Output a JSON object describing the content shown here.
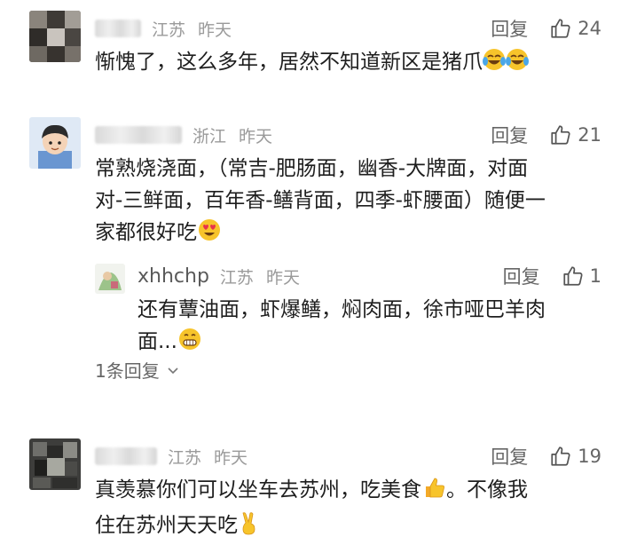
{
  "comments": [
    {
      "location": "江苏",
      "time": "昨天",
      "reply_label": "回复",
      "likes": "24",
      "text": "惭愧了，这么多年，居然不知道新区是猪爪"
    },
    {
      "location": "浙江",
      "time": "昨天",
      "reply_label": "回复",
      "likes": "21",
      "text_line1": "常熟烧浇面，（常吉-肥肠面，幽香-大牌面，对面",
      "text_line2": "对-三鲜面，百年香-鳝背面，四季-虾腰面）随便一",
      "text_line3": "家都很好吃",
      "reply": {
        "username": "xhhchp",
        "location": "江苏",
        "time": "昨天",
        "reply_label": "回复",
        "likes": "1",
        "text_line1": "还有蕈油面，虾爆鳝，焖肉面，徐市哑巴羊肉",
        "text_line2": "面..."
      },
      "replies_toggle": "1条回复"
    },
    {
      "location": "江苏",
      "time": "昨天",
      "reply_label": "回复",
      "likes": "19",
      "text_line1": "真羡慕你们可以坐车去苏州，吃美食",
      "text_line1_after": "。不像我",
      "text_line2": "住在苏州天天吃"
    }
  ]
}
